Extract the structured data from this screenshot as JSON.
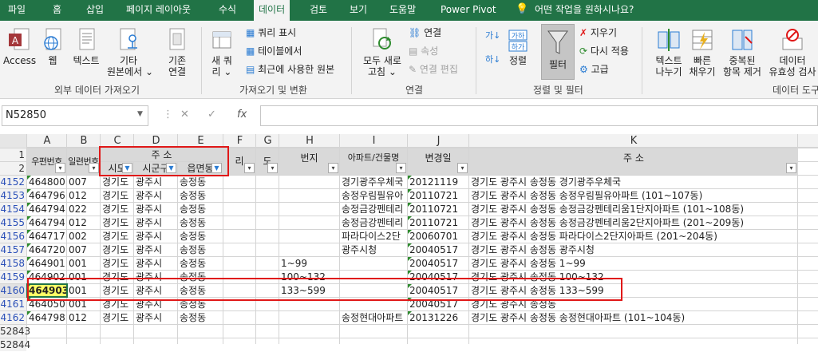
{
  "tabs": [
    "파일",
    "홈",
    "삽입",
    "페이지 레이아웃",
    "수식",
    "데이터",
    "검토",
    "보기",
    "도움말",
    "Power Pivot",
    "어떤 작업을 원하시나요?"
  ],
  "ribbon": {
    "access": "Access",
    "web": "웹",
    "text": "텍스트",
    "other": [
      "기타",
      "원본에서 ⌄"
    ],
    "existing": [
      "기존",
      "연결"
    ],
    "group1": "외부 데이터 가져오기",
    "newquery": [
      "새 쿼",
      "리 ⌄"
    ],
    "showquery": "쿼리 표시",
    "fromtable": "테이블에서",
    "recent": "최근에 사용한 원본",
    "group2": "가져오기 및 변환",
    "refresh": [
      "모두 새로",
      "고침 ⌄"
    ],
    "connections": "연결",
    "properties": "속성",
    "editlinks": "연결 편집",
    "group3": "연결",
    "sort": "정렬",
    "filter": "필터",
    "clear": "지우기",
    "reapply": "다시 적용",
    "advanced": "고급",
    "group4": "정렬 및 필터",
    "texttocol": [
      "텍스트",
      "나누기"
    ],
    "flash": [
      "빠른",
      "채우기"
    ],
    "removedup": [
      "중복된",
      "항목 제거"
    ],
    "validation": [
      "데이터",
      "유효성 검사"
    ],
    "group5": "데이터 도구"
  },
  "formula": {
    "namebox": "N52850",
    "fx": "fx",
    "cancel": "✕",
    "enter": "✓",
    "dots": "⋮",
    "more": "⋮"
  },
  "columns": [
    "A",
    "B",
    "C",
    "D",
    "E",
    "F",
    "G",
    "H",
    "I",
    "J",
    "K"
  ],
  "header_rows": [
    "1",
    "2"
  ],
  "headers": {
    "A": "우편번호",
    "B": "일련번호",
    "addr_group": "주 소",
    "C": "시도",
    "D": "시군구",
    "E": "읍면동",
    "F": "리",
    "G": "도",
    "H": "번지",
    "I": "아파트/건물명",
    "J": "변경일",
    "K": "주 소"
  },
  "rows": [
    {
      "n": "4152",
      "a": "464800",
      "b": "007",
      "c": "경기도",
      "d": "광주시",
      "e": "송정동",
      "h": "",
      "i": "경기광주우체국",
      "j": "20121119",
      "k": "경기도 광주시 송정동 경기광주우체국"
    },
    {
      "n": "4153",
      "a": "464796",
      "b": "012",
      "c": "경기도",
      "d": "광주시",
      "e": "송정동",
      "h": "",
      "i": "송정우림필유아",
      "j": "20110721",
      "k": "경기도 광주시 송정동 송정우림필유아파트 (101~107동)"
    },
    {
      "n": "4154",
      "a": "464794",
      "b": "022",
      "c": "경기도",
      "d": "광주시",
      "e": "송정동",
      "h": "",
      "i": "송정금강펜테리",
      "j": "20110721",
      "k": "경기도 광주시 송정동 송정금강펜테리움1단지아파트 (101~108동)"
    },
    {
      "n": "4155",
      "a": "464794",
      "b": "012",
      "c": "경기도",
      "d": "광주시",
      "e": "송정동",
      "h": "",
      "i": "송정금강펜테리",
      "j": "20110721",
      "k": "경기도 광주시 송정동 송정금강펜테리움2단지아파트 (201~209동)"
    },
    {
      "n": "4156",
      "a": "464717",
      "b": "002",
      "c": "경기도",
      "d": "광주시",
      "e": "송정동",
      "h": "",
      "i": "파라다이스2단",
      "j": "20060701",
      "k": "경기도 광주시 송정동 파라다이스2단지아파트 (201~204동)"
    },
    {
      "n": "4157",
      "a": "464720",
      "b": "007",
      "c": "경기도",
      "d": "광주시",
      "e": "송정동",
      "h": "",
      "i": "광주시청",
      "j": "20040517",
      "k": "경기도 광주시 송정동 광주시청"
    },
    {
      "n": "4158",
      "a": "464901",
      "b": "001",
      "c": "경기도",
      "d": "광주시",
      "e": "송정동",
      "h": "1~99",
      "i": "",
      "j": "20040517",
      "k": "경기도 광주시 송정동 1~99"
    },
    {
      "n": "4159",
      "a": "464902",
      "b": "001",
      "c": "경기도",
      "d": "광주시",
      "e": "송정동",
      "h": "100~132",
      "i": "",
      "j": "20040517",
      "k": "경기도 광주시 송정동 100~132"
    },
    {
      "n": "4160",
      "a": "464903",
      "b": "001",
      "c": "경기도",
      "d": "광주시",
      "e": "송정동",
      "h": "133~599",
      "i": "",
      "j": "20040517",
      "k": "경기도 광주시 송정동 133~599"
    },
    {
      "n": "4161",
      "a": "464050",
      "b": "001",
      "c": "경기도",
      "d": "광주시",
      "e": "송정동",
      "h": "",
      "i": "",
      "j": "20040517",
      "k": "경기도 광주시 송정동"
    },
    {
      "n": "4162",
      "a": "464798",
      "b": "012",
      "c": "경기도",
      "d": "광주시",
      "e": "송정동",
      "h": "",
      "i": "송정현대아파트",
      "j": "20131226",
      "k": "경기도 광주시 송정동 송정현대아파트 (101~104동)"
    },
    {
      "n": "52843",
      "a": "",
      "b": "",
      "c": "",
      "d": "",
      "e": "",
      "h": "",
      "i": "",
      "j": "",
      "k": ""
    },
    {
      "n": "52844",
      "a": "",
      "b": "",
      "c": "",
      "d": "",
      "e": "",
      "h": "",
      "i": "",
      "j": "",
      "k": ""
    }
  ],
  "colors": {
    "excel_green": "#217346",
    "row_number_blue": "#2a4fb8",
    "selection_yellow": "#ffff66",
    "annotation_red": "#e01818"
  }
}
